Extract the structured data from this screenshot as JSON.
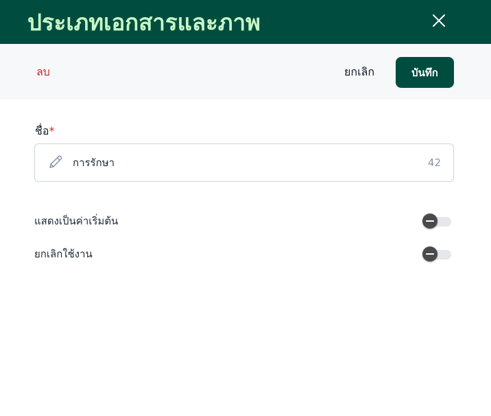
{
  "dialog": {
    "title": "ประเภทเอกสารและภาพ",
    "close_icon": "close-icon"
  },
  "toolbar": {
    "delete_label": "ลบ",
    "cancel_label": "ยกเลิก",
    "save_label": "บันทึก"
  },
  "form": {
    "name_label": "ชื่อ",
    "required_marker": "*",
    "name_value": "การรักษา",
    "name_char_count": "42",
    "name_icon": "pencil-icon"
  },
  "toggles": [
    {
      "label": "แสดงเป็นค่าเริ่มต้น",
      "state": "off"
    },
    {
      "label": "ยกเลิกใช้งาน",
      "state": "off"
    }
  ],
  "colors": {
    "header_bg": "#004d40",
    "title_text": "#c8f7c5",
    "save_bg": "#004d40",
    "delete_text": "#c62828",
    "toolbar_bg": "#f6f8fa"
  }
}
